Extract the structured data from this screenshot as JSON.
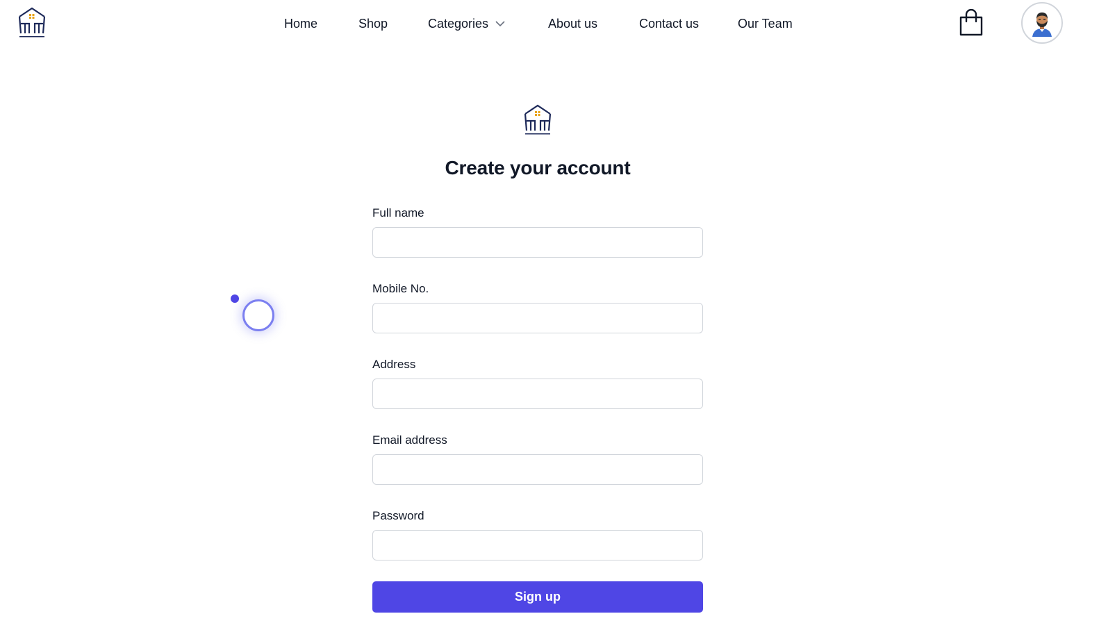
{
  "nav": {
    "items": [
      {
        "label": "Home"
      },
      {
        "label": "Shop"
      },
      {
        "label": "Categories"
      },
      {
        "label": "About us"
      },
      {
        "label": "Contact us"
      },
      {
        "label": "Our Team"
      }
    ]
  },
  "header": {
    "cart_icon": "shopping-bag-icon",
    "avatar_icon": "user-avatar"
  },
  "form": {
    "title": "Create your account",
    "fields": [
      {
        "label": "Full name",
        "value": "",
        "placeholder": ""
      },
      {
        "label": "Mobile No.",
        "value": "",
        "placeholder": ""
      },
      {
        "label": "Address",
        "value": "",
        "placeholder": ""
      },
      {
        "label": "Email address",
        "value": "",
        "placeholder": ""
      },
      {
        "label": "Password",
        "value": "",
        "placeholder": ""
      }
    ],
    "submit_label": "Sign up"
  },
  "colors": {
    "accent": "#4f46e5",
    "logo_navy": "#1e2a5a",
    "logo_gold": "#e8a317"
  }
}
